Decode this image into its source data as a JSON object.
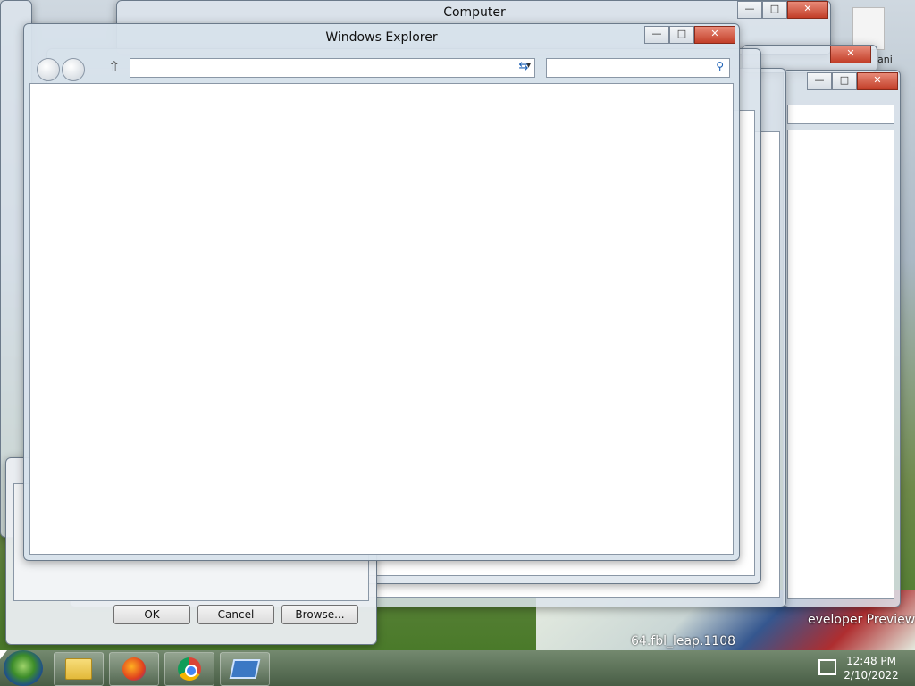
{
  "desktop": {
    "watermark_line1": "eveloper Preview",
    "watermark_line2": "64.fbl_leap.1108",
    "icon_label": "ani"
  },
  "background_windows": {
    "computer_title": "Computer"
  },
  "main_window": {
    "title": "Windows Explorer",
    "address_value": "",
    "search_placeholder": ""
  },
  "dialog": {
    "ok_label": "OK",
    "cancel_label": "Cancel",
    "browse_label": "Browse..."
  },
  "taskbar": {
    "pinned": [
      "windows-explorer",
      "firefox",
      "chrome",
      "app"
    ],
    "clock_time": "12:48 PM",
    "clock_date": "2/10/2022"
  },
  "icons": {
    "minimize": "—",
    "maximize": "□",
    "close": "✕",
    "up": "⇧",
    "dropdown": "▾",
    "refresh": "⇆",
    "search": "⚲"
  }
}
